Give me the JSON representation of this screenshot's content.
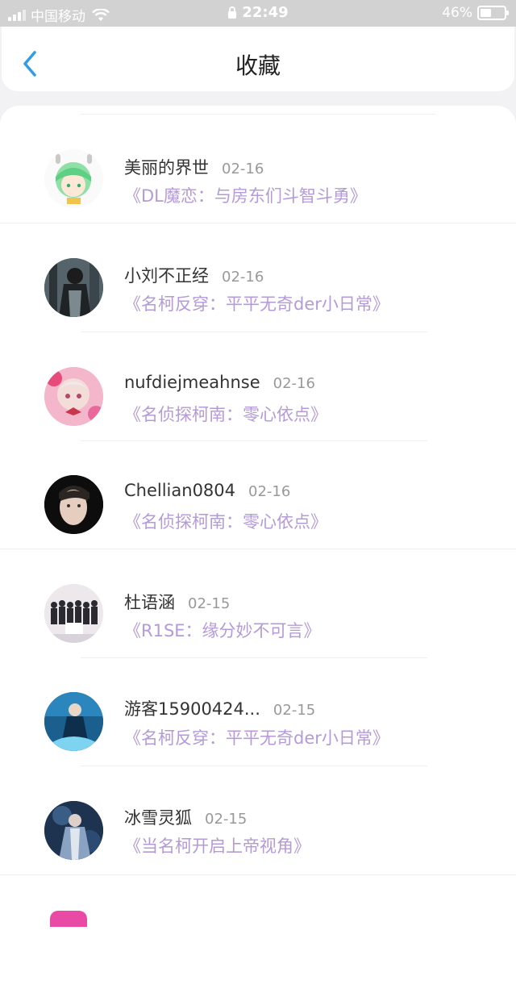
{
  "status_bar": {
    "carrier": "中国移动",
    "time": "22:49",
    "battery_text": "46%",
    "battery_level": 0.46
  },
  "nav": {
    "title": "收藏",
    "back_icon": "chevron-left-icon"
  },
  "colors": {
    "accent": "#2f9ee8",
    "book_title": "#b49ad9",
    "date": "#999999"
  },
  "items": [
    {
      "user": "美丽的界世",
      "date": "02-16",
      "book": "《DL魔恋：与房东们斗智斗勇》",
      "avatar": "anime-girl-green-hair"
    },
    {
      "user": "小刘不正经",
      "date": "02-16",
      "book": "《名柯反穿：平平无奇der小日常》",
      "avatar": "dark-hair-figure"
    },
    {
      "user": "nufdiejmeahnse",
      "date": "02-16",
      "book": "《名侦探柯南：零心依点》",
      "avatar": "anime-girl-pink"
    },
    {
      "user": "Chellian0804",
      "date": "02-16",
      "book": "《名侦探柯南：零心依点》",
      "avatar": "portrait-dark"
    },
    {
      "user": "杜语涵",
      "date": "02-15",
      "book": "《R1SE：缘分妙不可言》",
      "avatar": "group-photo"
    },
    {
      "user": "游客15900424...",
      "date": "02-15",
      "book": "《名柯反穿：平平无奇der小日常》",
      "avatar": "blue-figure"
    },
    {
      "user": "冰雪灵狐",
      "date": "02-15",
      "book": "《当名柯开启上帝视角》",
      "avatar": "dark-blue-figure"
    }
  ]
}
